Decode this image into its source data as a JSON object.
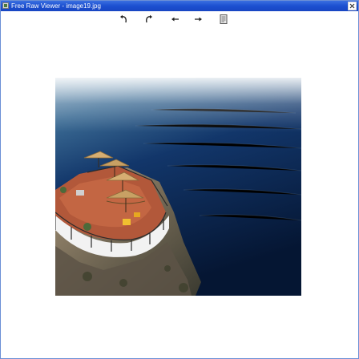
{
  "window": {
    "title": "Free Raw Viewer - image19.jpg",
    "titlebar_color": "#1c4fd0",
    "close_icon": "close-icon"
  },
  "toolbar": {
    "items": [
      {
        "name": "rotate-left-button",
        "icon": "rotate-left-icon",
        "label": ""
      },
      {
        "name": "rotate-right-button",
        "icon": "rotate-right-icon",
        "label": ""
      },
      {
        "name": "previous-image-button",
        "icon": "arrow-left-icon",
        "label": ""
      },
      {
        "name": "next-image-button",
        "icon": "arrow-right-icon",
        "label": ""
      },
      {
        "name": "properties-button",
        "icon": "document-icon",
        "label": ""
      }
    ]
  },
  "image": {
    "file_name": "image19.jpg",
    "subject": "photo",
    "colors": {
      "sea_top": "#5a86a8",
      "sea_bottom": "#061a38",
      "cliff": "#8a7a62",
      "terrace_floor": "#b85a3a",
      "parasol": "#c8a064"
    }
  }
}
